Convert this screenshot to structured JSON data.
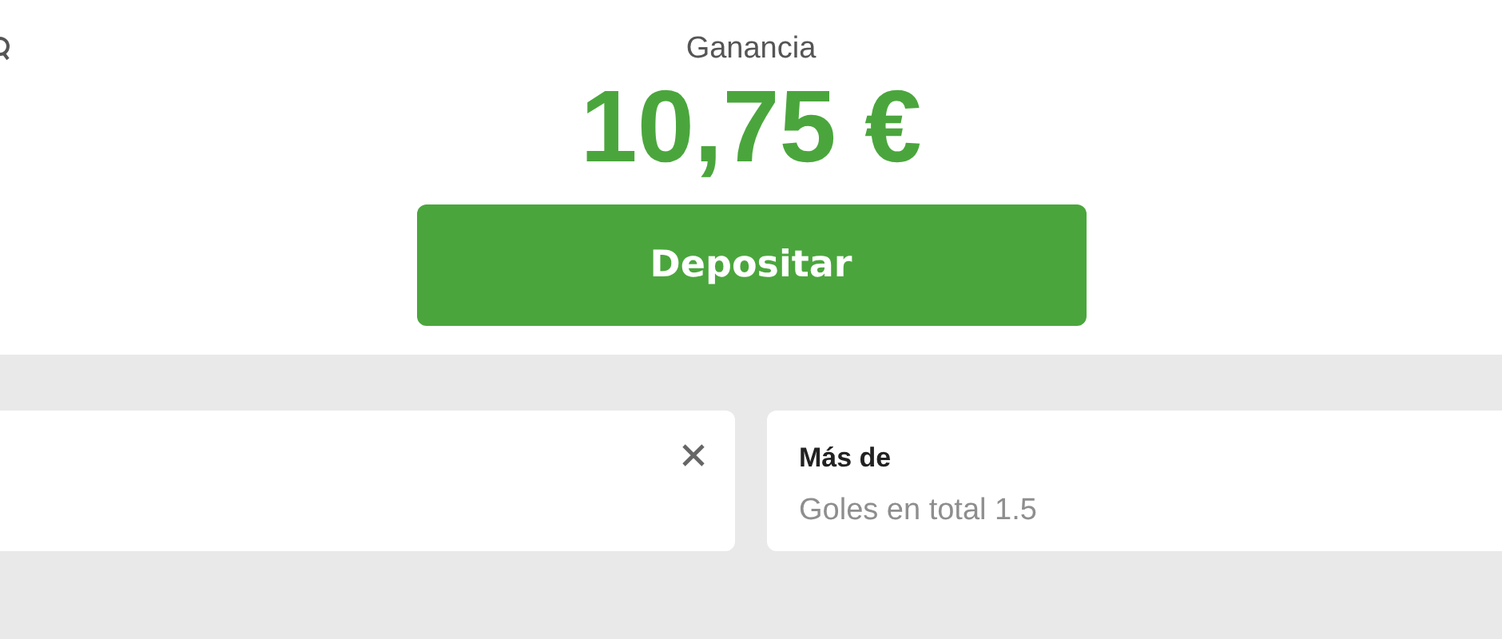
{
  "header": {
    "label": "Ganancia",
    "amount": "10,75 €"
  },
  "deposit_button": {
    "label": "Depositar"
  },
  "selections": [
    {
      "kind": "removable"
    },
    {
      "kind": "market",
      "title": "Más de",
      "subtitle": "Goles en total 1.5"
    }
  ]
}
